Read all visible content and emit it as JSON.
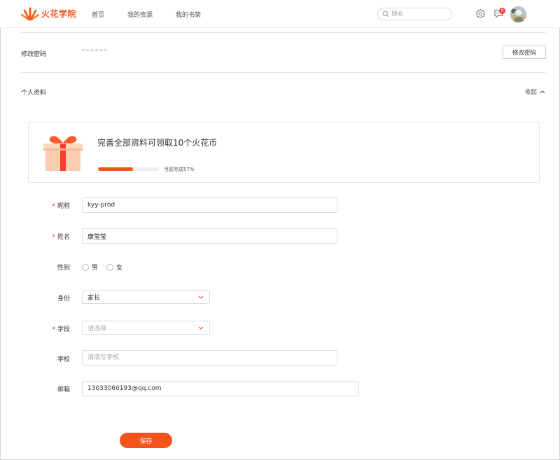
{
  "header": {
    "brand": "火花学院",
    "nav": [
      "首页",
      "我的资源",
      "我的书架"
    ],
    "search_placeholder": "搜索",
    "message_count": "0"
  },
  "password_row": {
    "label": "修改密码",
    "mask": "^^^^^^",
    "button": "修改密码"
  },
  "profile_section": {
    "label": "个人资料",
    "collapse": "收起"
  },
  "promo": {
    "title": "完善全部资料可领取10个火花币",
    "progress_text": "当前完成57%",
    "progress_percent": 57
  },
  "form": {
    "nickname": {
      "label": "昵称",
      "value": "kyy-prod",
      "required": "*"
    },
    "name": {
      "label": "姓名",
      "value": "康莹莹",
      "required": "*"
    },
    "gender": {
      "label": "性别",
      "options": [
        "男",
        "女"
      ]
    },
    "identity": {
      "label": "身份",
      "value": "家长"
    },
    "school_stage": {
      "label": "学段",
      "placeholder": "请选择",
      "required": "*"
    },
    "school": {
      "label": "学校",
      "placeholder": "请填写学校"
    },
    "email": {
      "label": "邮箱",
      "value": "13033060193@qq.com"
    },
    "save": "保存"
  },
  "colors": {
    "accent": "#f2541b",
    "required": "#e33333"
  }
}
